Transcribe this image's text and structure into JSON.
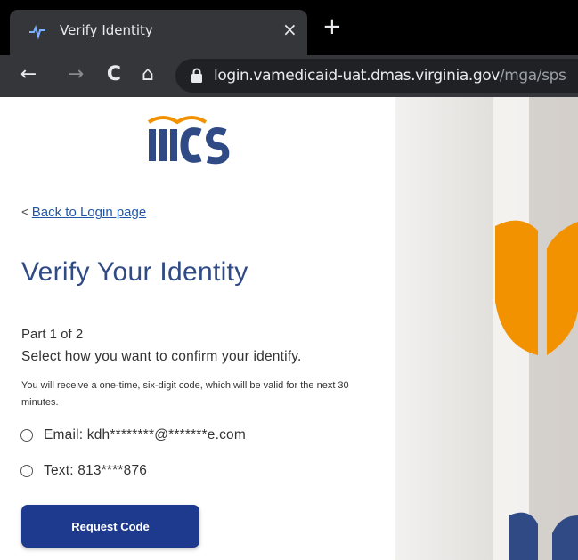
{
  "browser": {
    "tab_title": "Verify Identity",
    "close_glyph": "×",
    "new_tab_glyph": "+",
    "url_host": "login.vamedicaid-uat.dmas.virginia.gov",
    "url_path": "/mga/sps",
    "back_glyph": "←",
    "forward_glyph": "→",
    "reload_glyph": "C",
    "home_glyph": "⌂",
    "icons": [
      "back-icon",
      "forward-icon",
      "reload-icon",
      "home-icon",
      "lock-icon",
      "favicon-icon"
    ]
  },
  "page": {
    "logo_text": "MCS",
    "back_chevron": "<",
    "back_link": "Back to Login page",
    "title": "Verify Your Identity",
    "part": "Part 1 of 2",
    "select_label": "Select how you want to confirm your identify.",
    "note": "You will receive a one-time, six-digit code, which will be valid for the next 30 minutes.",
    "options": [
      {
        "label": "Email: kdh********@*******e.com",
        "selected": false
      },
      {
        "label": "Text: 813****876",
        "selected": false
      }
    ],
    "button_label": "Request Code"
  },
  "colors": {
    "brand_blue": "#2f4a85",
    "button_blue": "#1e3a8f",
    "logo_orange": "#f39200",
    "link_blue": "#2257a8"
  }
}
